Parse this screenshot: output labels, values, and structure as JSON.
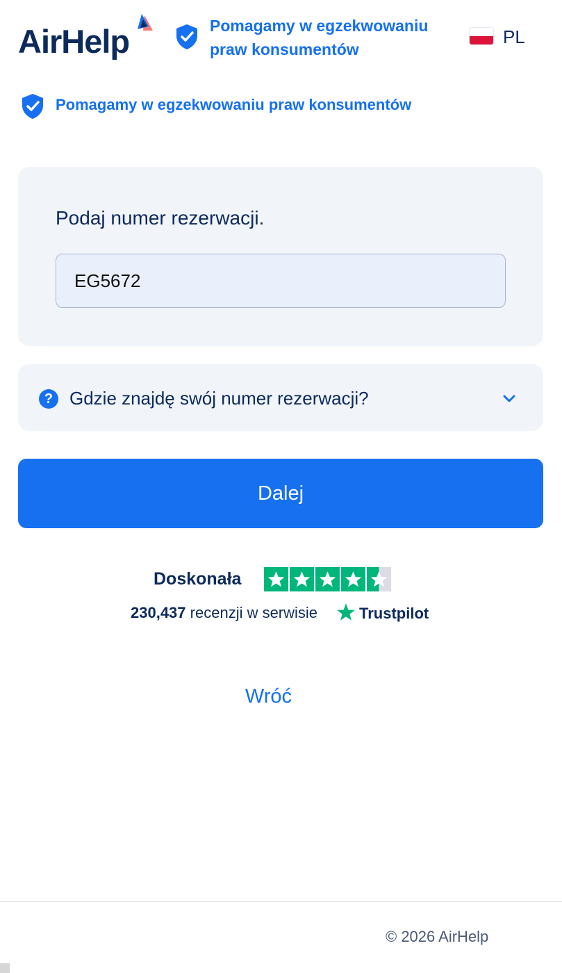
{
  "header": {
    "logo_text": "AirHelp",
    "claim": "Pomagamy w egzekwowaniu praw konsumentów",
    "language_code": "PL"
  },
  "subclaim": "Pomagamy w egzekwowaniu praw konsumentów",
  "form": {
    "label": "Podaj numer rezerwacji.",
    "booking_value": "EG5672"
  },
  "faq": {
    "question": "Gdzie znajdę swój numer rezerwacji?"
  },
  "actions": {
    "continue_label": "Dalej",
    "back_label": "Wróć"
  },
  "trustpilot": {
    "rating_label": "Doskonała",
    "review_count": "230,437",
    "reviews_text": "recenzji w serwisie",
    "brand": "Trustpilot",
    "stars": 4.5
  },
  "footer": {
    "copyright": "© 2026 AirHelp"
  },
  "colors": {
    "primary": "#1670f0",
    "navy": "#0c2a5c",
    "trustpilot_green": "#00b67a",
    "card_bg": "#f1f4f9"
  }
}
